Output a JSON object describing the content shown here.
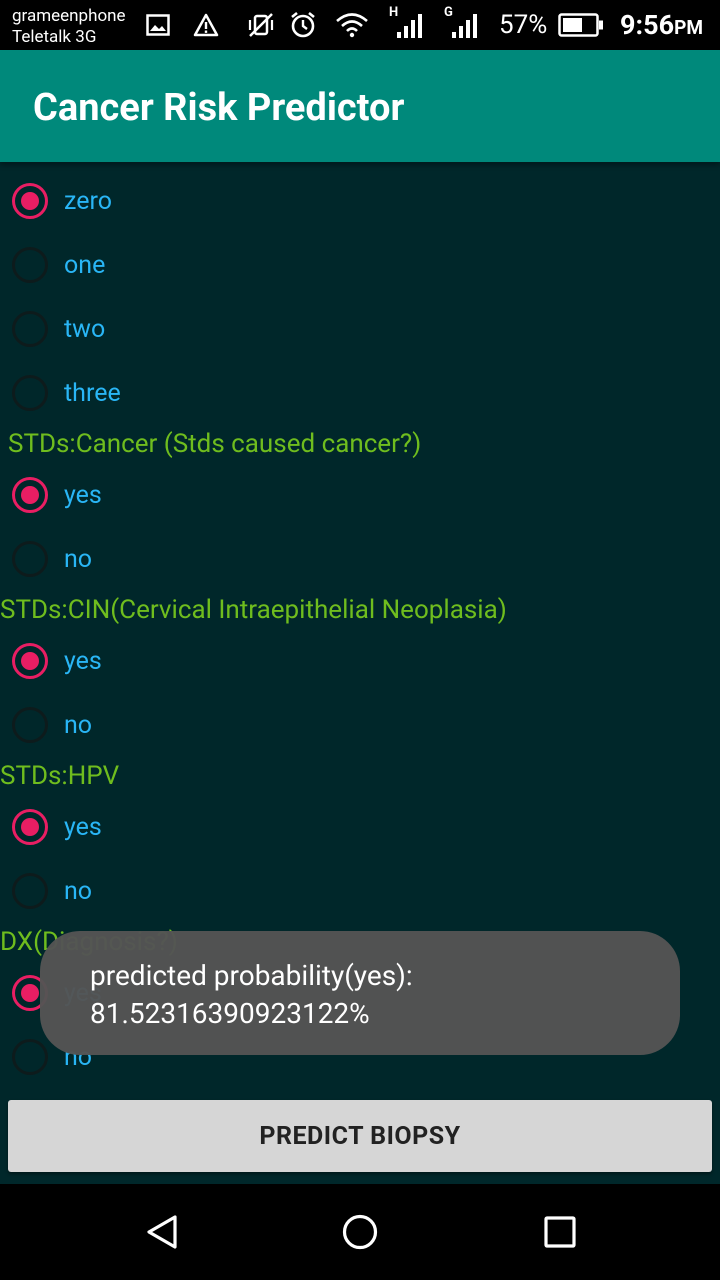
{
  "status_bar": {
    "carrier_primary": "grameenphone",
    "carrier_secondary": "Teletalk 3G",
    "network_h": "H",
    "network_g": "G",
    "battery": "57%",
    "time": "9:56",
    "time_suffix": "PM"
  },
  "app": {
    "title": "Cancer Risk Predictor"
  },
  "form": {
    "first_group_options": [
      {
        "label": "zero",
        "selected": true
      },
      {
        "label": "one",
        "selected": false
      },
      {
        "label": "two",
        "selected": false
      },
      {
        "label": "three",
        "selected": false
      }
    ],
    "sections": [
      {
        "title": "STDs:Cancer (Stds caused cancer?)",
        "options": [
          {
            "label": "yes",
            "selected": true
          },
          {
            "label": "no",
            "selected": false
          }
        ]
      },
      {
        "title": "STDs:CIN(Cervical Intraepithelial Neoplasia)",
        "options": [
          {
            "label": "yes",
            "selected": true
          },
          {
            "label": "no",
            "selected": false
          }
        ]
      },
      {
        "title": "STDs:HPV",
        "options": [
          {
            "label": "yes",
            "selected": true
          },
          {
            "label": "no",
            "selected": false
          }
        ]
      },
      {
        "title": "DX(Diagnosis?)",
        "options": [
          {
            "label": "yes",
            "selected": true
          },
          {
            "label": "no",
            "selected": false
          }
        ]
      }
    ]
  },
  "toast": {
    "line1": "predicted probability(yes):",
    "line2": "81.52316390923122%"
  },
  "actions": {
    "predict_label": "PREDICT BIOPSY"
  },
  "colors": {
    "app_bar": "#00897b",
    "background": "#00272a",
    "accent": "#e91e63",
    "option_text": "#29b6f6",
    "section_text": "#6fbd1e"
  }
}
